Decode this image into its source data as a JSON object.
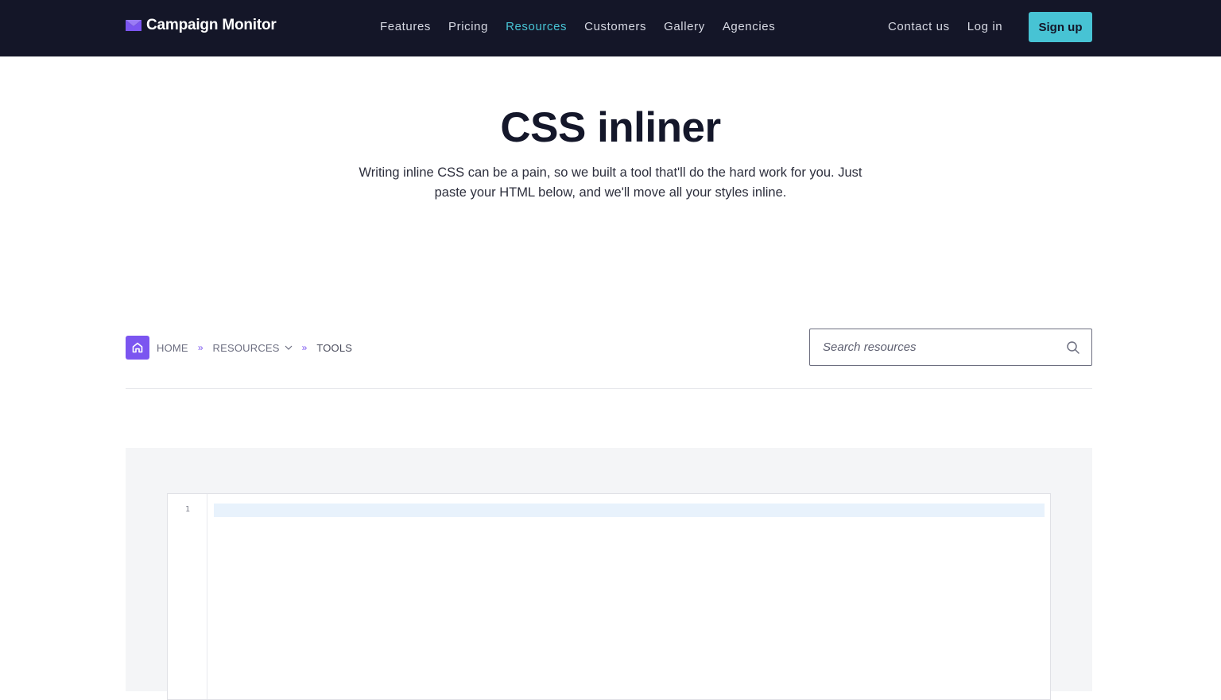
{
  "brand": {
    "name": "Campaign Monitor",
    "logo_color": "#7b55f0"
  },
  "nav": {
    "items": [
      {
        "label": "Features"
      },
      {
        "label": "Pricing"
      },
      {
        "label": "Resources",
        "active": true
      },
      {
        "label": "Customers"
      },
      {
        "label": "Gallery"
      },
      {
        "label": "Agencies"
      }
    ],
    "contact_label": "Contact us",
    "login_label": "Log in",
    "signup_label": "Sign up",
    "active_color": "#47c3d4",
    "background": "#141628"
  },
  "hero": {
    "title": "CSS inliner",
    "subtitle": "Writing inline CSS can be a pain, so we built a tool that'll do the hard work for you. Just paste your HTML below, and we'll move all your styles inline."
  },
  "breadcrumb": {
    "home_icon": "home-icon",
    "items": [
      {
        "label": "HOME"
      },
      {
        "label": "RESOURCES",
        "has_dropdown": true
      },
      {
        "label": "TOOLS"
      }
    ],
    "separator": "»"
  },
  "search": {
    "placeholder": "Search resources",
    "value": "",
    "icon": "search-icon"
  },
  "editor": {
    "line_numbers": [
      "1"
    ],
    "content": ""
  }
}
